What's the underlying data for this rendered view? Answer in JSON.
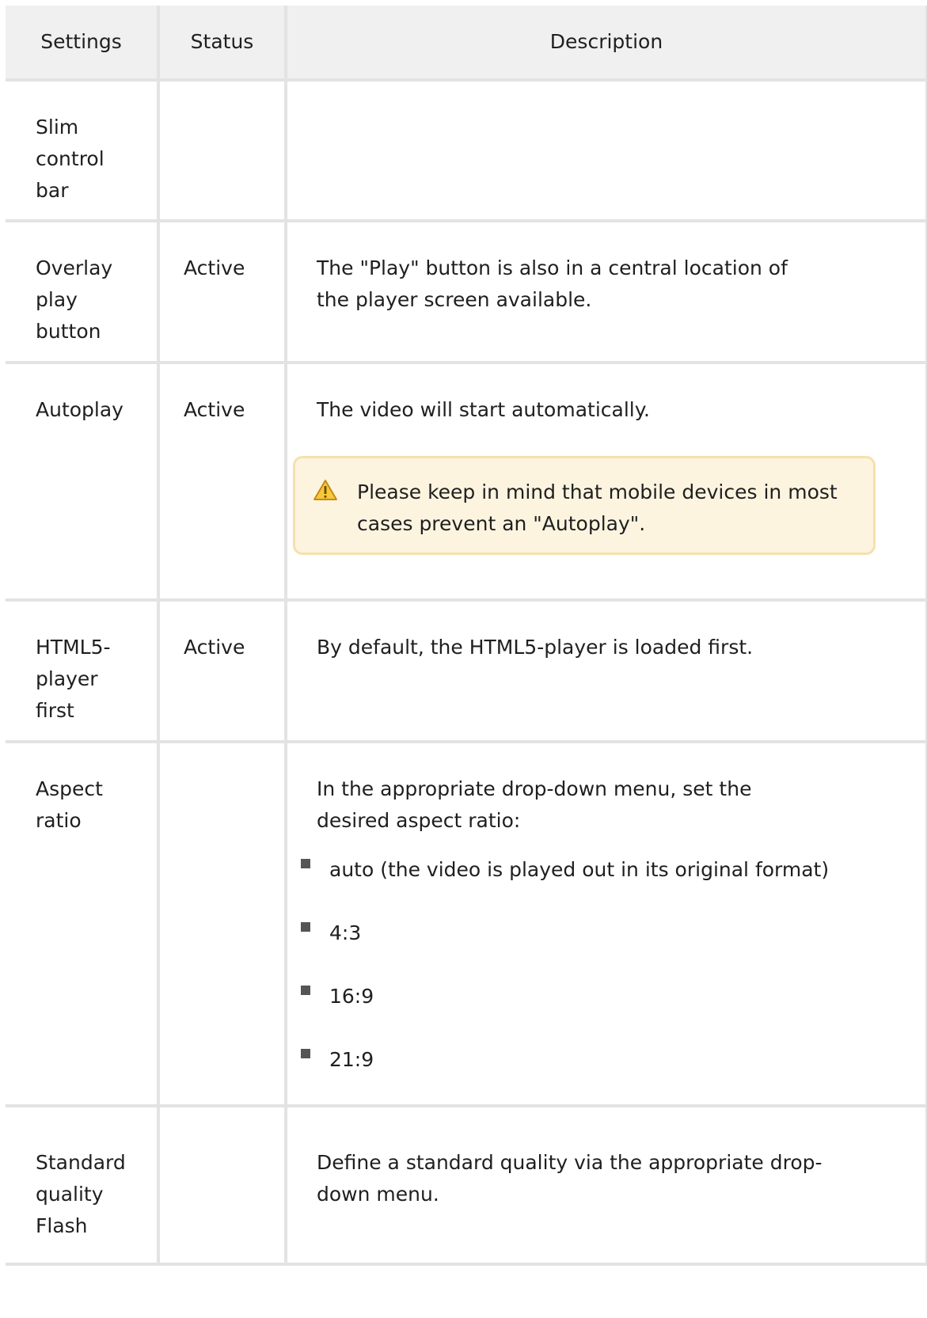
{
  "table": {
    "headers": [
      "Settings",
      "Status",
      "Description"
    ],
    "rows": [
      {
        "setting": [
          "Slim",
          "control",
          "bar"
        ],
        "status": "",
        "description": ""
      },
      {
        "setting": [
          "Overlay",
          "play",
          "button"
        ],
        "status": "Active",
        "description": "The \"Play\" button is also in a central location of the player screen available."
      },
      {
        "setting": [
          "Autoplay"
        ],
        "status": "Active",
        "description": "The video will start automatically.",
        "note": {
          "icon": "warning-icon",
          "text": "Please keep in mind that mobile devices in most cases prevent an \"Autoplay\"."
        }
      },
      {
        "setting": [
          "HTML5-",
          "player",
          "first"
        ],
        "status": "Active",
        "description": "By default, the HTML5-player is loaded first."
      },
      {
        "setting": [
          "Aspect",
          "ratio"
        ],
        "status": "",
        "description": "In the appropriate drop-down menu, set the desired aspect ratio:",
        "options": [
          "auto (the video is played out in its original format)",
          "4:3",
          "16:9",
          "21:9"
        ]
      },
      {
        "setting": [
          "Standard",
          "quality",
          "Flash"
        ],
        "status": "",
        "description": "Define a standard quality via the appropriate drop-down menu."
      }
    ]
  },
  "colors": {
    "border": "#e3e3e3",
    "header_bg": "#f0f0f0",
    "note_bg": "#fdf4e0",
    "note_border": "#f5e1ad",
    "warning_icon": "#e8b416"
  }
}
